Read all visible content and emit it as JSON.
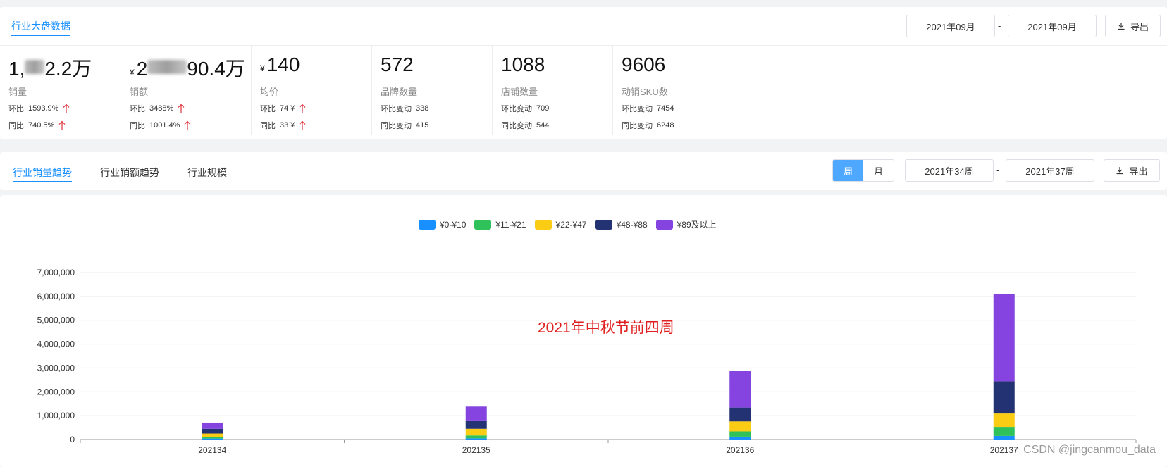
{
  "panel_overview": {
    "title": "行业大盘数据",
    "date_start": "2021年09月",
    "date_sep": "-",
    "date_end": "2021年09月",
    "export_label": "导出"
  },
  "metrics": [
    {
      "value_pre": "1,",
      "value_post": "2.2万",
      "yen": "",
      "blur": "short",
      "label": "销量",
      "row1_label": "环比",
      "row1_value": "1593.9%",
      "row2_label": "同比",
      "row2_value": "740.5%",
      "arrows": true
    },
    {
      "value_pre": "2",
      "value_post": "90.4万",
      "yen": "¥",
      "blur": "wide",
      "label": "销额",
      "row1_label": "环比",
      "row1_value": "3488%",
      "row2_label": "同比",
      "row2_value": "1001.4%",
      "arrows": true
    },
    {
      "value_pre": "140",
      "value_post": "",
      "yen": "¥",
      "blur": "",
      "label": "均价",
      "row1_label": "环比",
      "row1_value": "74 ¥",
      "row2_label": "同比",
      "row2_value": "33 ¥",
      "arrows": true
    },
    {
      "value_pre": "572",
      "value_post": "",
      "yen": "",
      "blur": "",
      "label": "品牌数量",
      "row1_label": "环比变动",
      "row1_value": "338",
      "row2_label": "同比变动",
      "row2_value": "415",
      "arrows": false
    },
    {
      "value_pre": "1088",
      "value_post": "",
      "yen": "",
      "blur": "",
      "label": "店铺数量",
      "row1_label": "环比变动",
      "row1_value": "709",
      "row2_label": "同比变动",
      "row2_value": "544",
      "arrows": false
    },
    {
      "value_pre": "9606",
      "value_post": "",
      "yen": "",
      "blur": "",
      "label": "动销SKU数",
      "row1_label": "环比变动",
      "row1_value": "7454",
      "row2_label": "同比变动",
      "row2_value": "6248",
      "arrows": false
    }
  ],
  "trend_panel": {
    "tabs": [
      "行业销量趋势",
      "行业销额趋势",
      "行业规模"
    ],
    "active_tab": 0,
    "period_week": "周",
    "period_month": "月",
    "date_start": "2021年34周",
    "date_sep": "-",
    "date_end": "2021年37周",
    "export_label": "导出"
  },
  "colors": {
    "accent": "#1890ff",
    "up_arrow": "#e0414a",
    "annotation": "#e02020"
  },
  "annotation": "2021年中秋节前四周",
  "watermark": "CSDN @jingcanmou_data",
  "chart_data": {
    "type": "bar",
    "stacked": true,
    "categories": [
      "202134",
      "202135",
      "202136",
      "202137"
    ],
    "series": [
      {
        "name": "¥0-¥10",
        "color": "#1890ff",
        "values": [
          40000,
          50000,
          120000,
          150000
        ]
      },
      {
        "name": "¥11-¥21",
        "color": "#2fc25b",
        "values": [
          70000,
          120000,
          220000,
          380000
        ]
      },
      {
        "name": "¥22-¥47",
        "color": "#facc14",
        "values": [
          140000,
          280000,
          420000,
          560000
        ]
      },
      {
        "name": "¥48-¥88",
        "color": "#223273",
        "values": [
          200000,
          350000,
          580000,
          1350000
        ]
      },
      {
        "name": "¥89及以上",
        "color": "#8543e0",
        "values": [
          260000,
          580000,
          1550000,
          3650000
        ]
      }
    ],
    "ylim": [
      0,
      7000000
    ],
    "yticks": [
      0,
      1000000,
      2000000,
      3000000,
      4000000,
      5000000,
      6000000,
      7000000
    ],
    "ytick_labels": [
      "0",
      "1,000,000",
      "2,000,000",
      "3,000,000",
      "4,000,000",
      "5,000,000",
      "6,000,000",
      "7,000,000"
    ],
    "grid": true,
    "legend": "top-center"
  }
}
